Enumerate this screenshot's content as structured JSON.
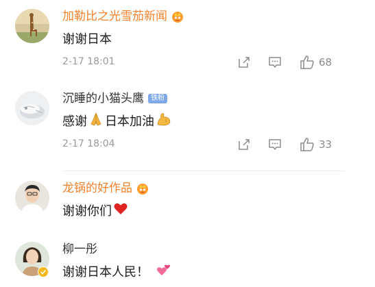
{
  "comments": [
    {
      "username": "加勒比之光雪茄新闻",
      "text": "谢谢日本",
      "time": "2-17 18:01",
      "likes": "68",
      "badge": "crown-icon",
      "name_color": "#f6812a"
    },
    {
      "username": "沉睡的小猫头鹰",
      "badge_text": "铁粉",
      "text_before": "感谢",
      "text_after": "日本加油",
      "time": "2-17 18:04",
      "likes": "33",
      "name_color": "#333333"
    },
    {
      "username": "龙锅的好作品",
      "text": "谢谢你们",
      "badge": "crown-icon",
      "name_color": "#f6812a"
    },
    {
      "username": "柳一彤",
      "text": "谢谢日本人民！",
      "name_color": "#333333"
    }
  ],
  "icons": {
    "share": "share-icon",
    "comment": "comment-icon",
    "like": "thumbs-up-icon",
    "pray": "pray-emoji",
    "muscle": "flexed-biceps-emoji",
    "heart": "red-heart-emoji",
    "hearts": "revolving-hearts-emoji",
    "verified": "verified-badge-icon"
  }
}
